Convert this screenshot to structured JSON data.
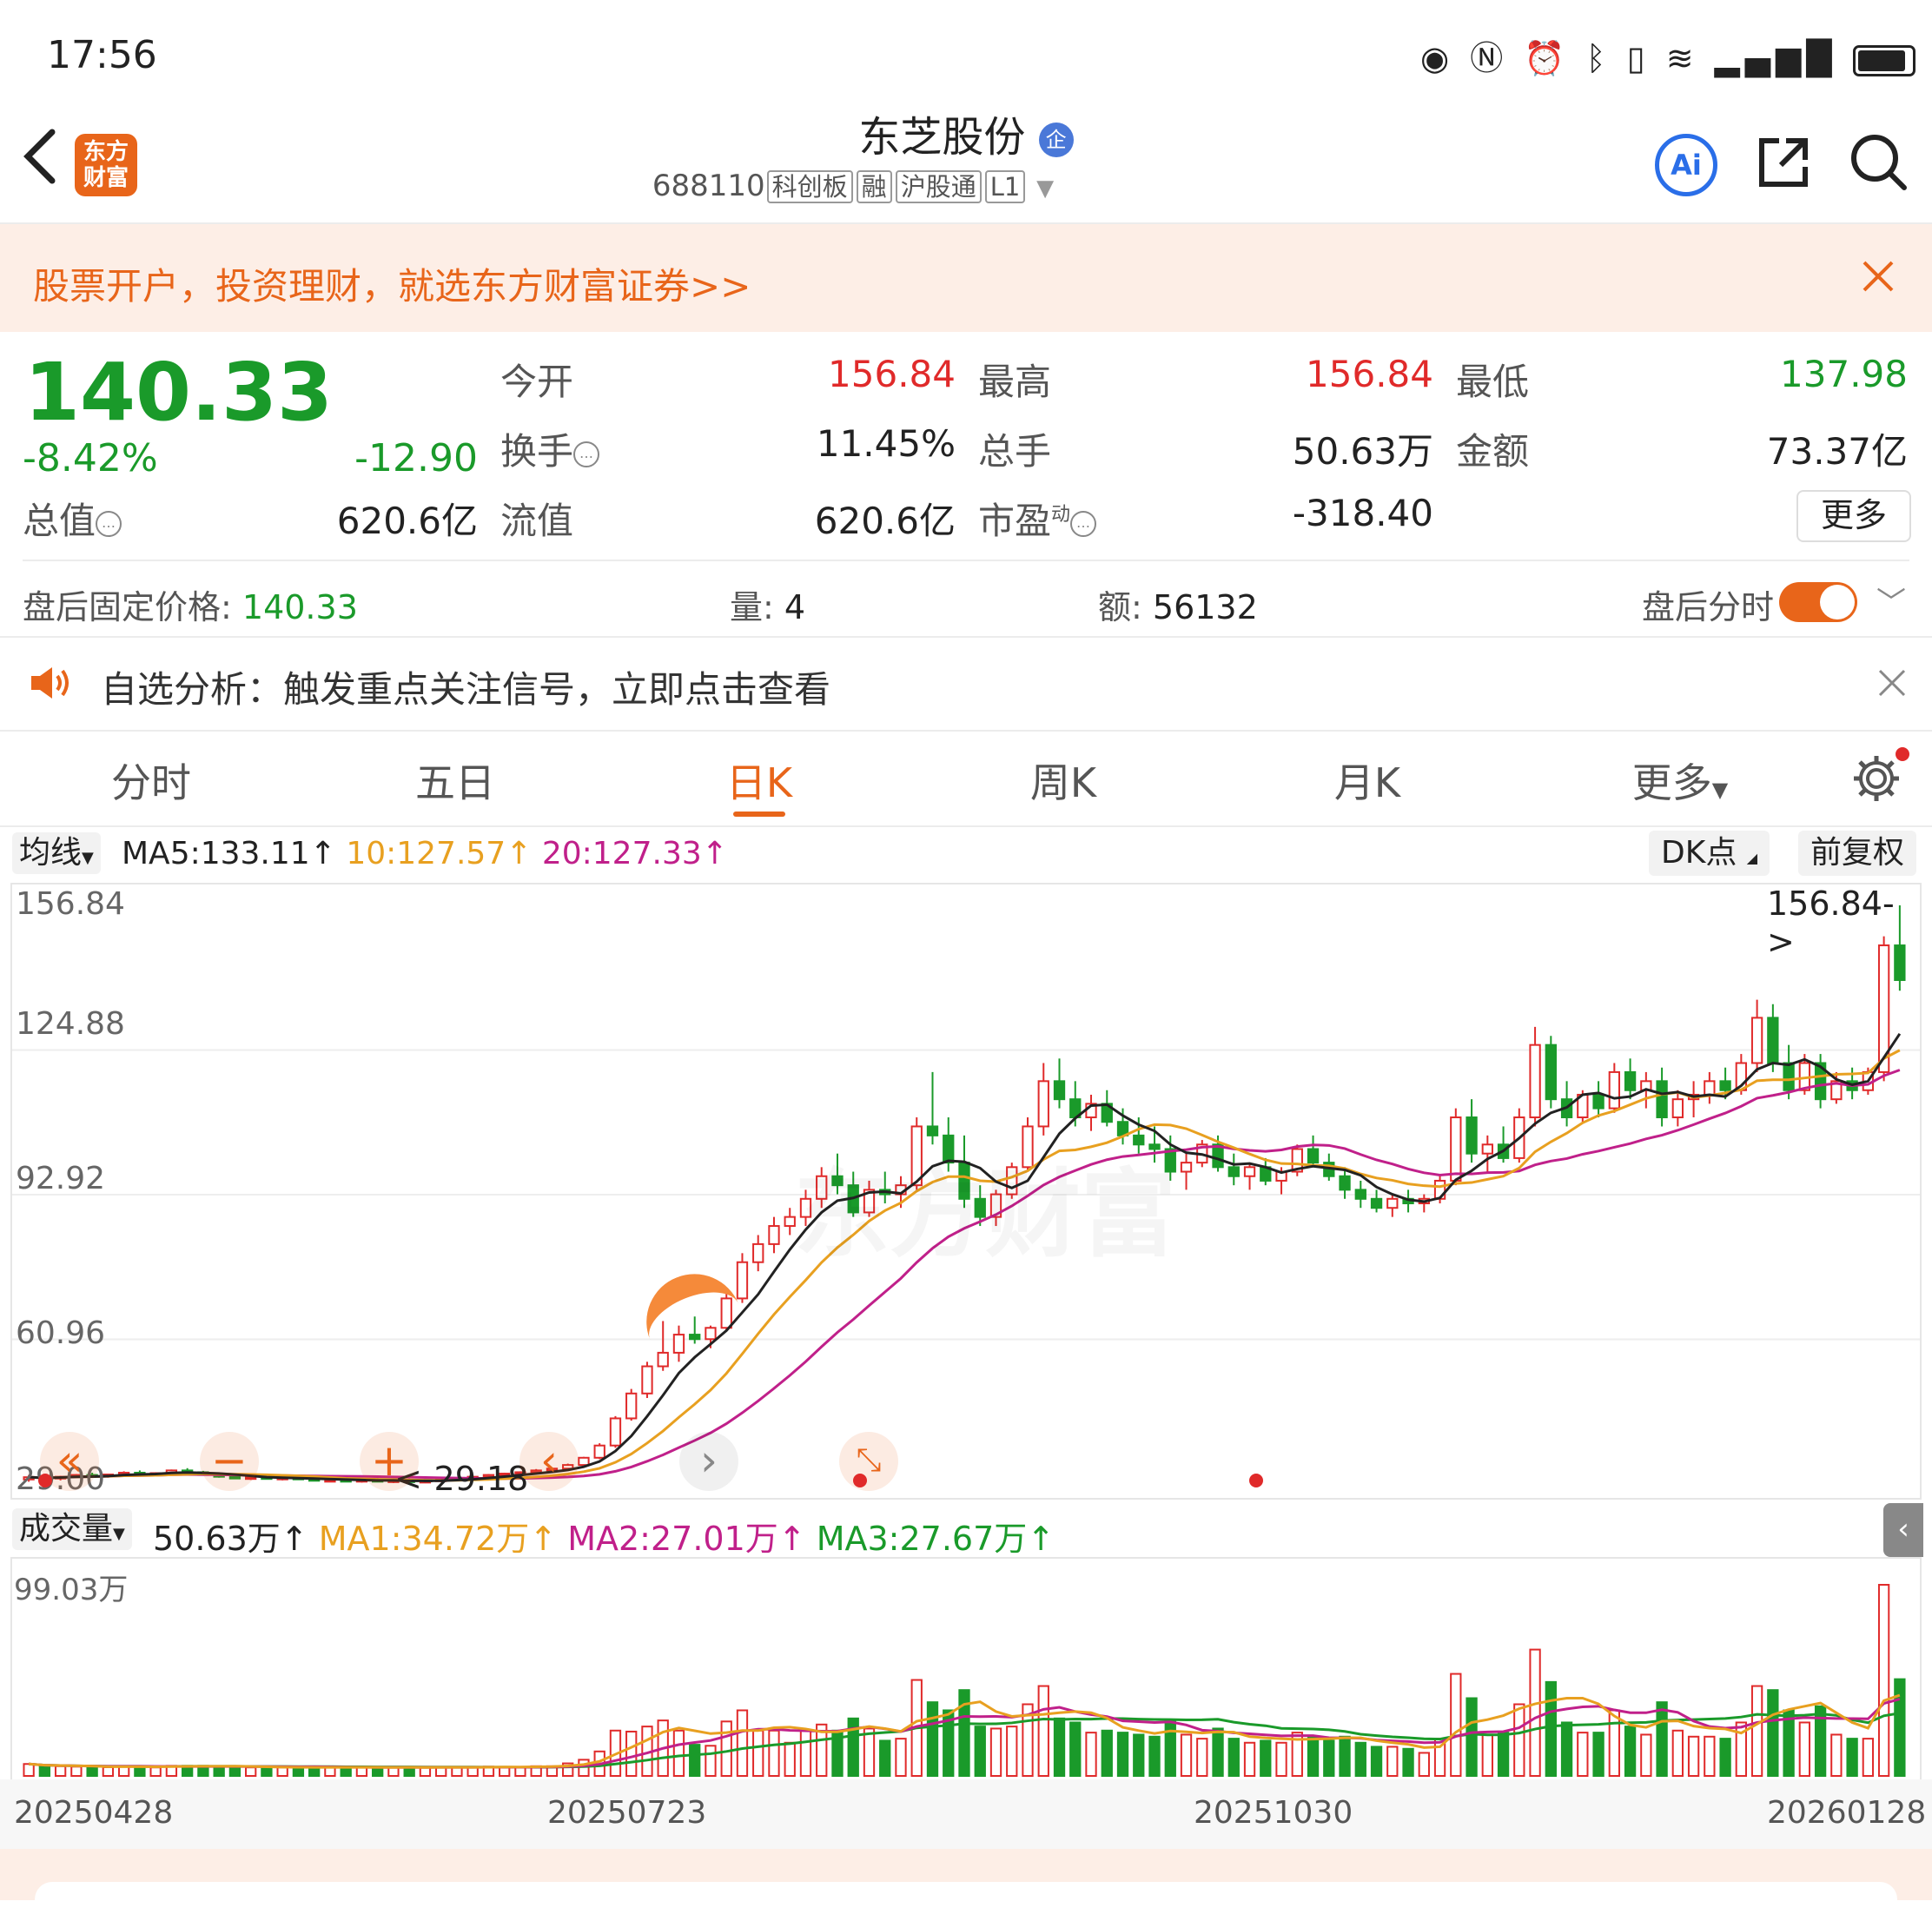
{
  "status_bar": {
    "time": "17:56"
  },
  "header": {
    "back_icon": "chevron-left-icon",
    "logo_text_top": "东方",
    "logo_text_bottom": "财富",
    "title": "东芝股份",
    "badge": "企",
    "code": "688110",
    "tags": [
      "科创板",
      "融",
      "沪股通",
      "L1"
    ],
    "actions": [
      "ai-icon",
      "share-icon",
      "search-icon"
    ],
    "ai_label": "Ai"
  },
  "banner": {
    "text": "股票开户，投资理财，就选东方财富证券>>"
  },
  "quote": {
    "price": "140.33",
    "change_pct": "-8.42%",
    "change": "-12.90",
    "labels": {
      "open": "今开",
      "high": "最高",
      "low": "最低",
      "turnover": "换手",
      "volume": "总手",
      "amount": "金额",
      "mkt_cap": "总值",
      "float_cap": "流值",
      "pe": "市盈",
      "pe_sup": "动"
    },
    "values": {
      "open": "156.84",
      "high": "156.84",
      "low": "137.98",
      "turnover": "11.45%",
      "volume": "50.63万",
      "amount": "73.37亿",
      "mkt_cap": "620.6亿",
      "float_cap": "620.6亿",
      "pe": "-318.40"
    },
    "more_button": "更多"
  },
  "after_hours": {
    "price_label": "盘后固定价格:",
    "price": "140.33",
    "vol_label": "量:",
    "vol": "4",
    "amt_label": "额:",
    "amt": "56132",
    "toggle_label": "盘后分时"
  },
  "notice": {
    "text": "自选分析：触发重点关注信号，立即点击查看"
  },
  "tabs": [
    "分时",
    "五日",
    "日K",
    "周K",
    "月K",
    "更多"
  ],
  "active_tab": "日K",
  "ma_bar": {
    "selector": "均线",
    "ma5": "MA5:133.11↑",
    "ma10": "10:127.57↑",
    "ma20": "20:127.33↑",
    "dk": "DK点",
    "fq": "前复权"
  },
  "price_axis": [
    "156.84",
    "124.88",
    "92.92",
    "60.96",
    "29.00"
  ],
  "marks": {
    "max": "156.84->",
    "min": "<-29.18"
  },
  "vol_bar": {
    "selector": "成交量",
    "vol": "50.63万↑",
    "ma1": "MA1:34.72万↑",
    "ma2": "MA2:27.01万↑",
    "ma3": "MA3:27.67万↑"
  },
  "vol_axis": {
    "top": "99.03万"
  },
  "date_axis": [
    "20250428",
    "20250723",
    "20251030",
    "20260128"
  ],
  "colors": {
    "up": "#e02a2a",
    "down": "#1a9a2a",
    "accent": "#e8651a",
    "ma5": "#222222",
    "ma10": "#e8a020",
    "ma20": "#c0208a"
  },
  "chart_data": {
    "type": "candlestick",
    "ylim": [
      29.0,
      156.84
    ],
    "candles": [
      [
        30,
        31,
        29.5,
        30.5
      ],
      [
        30.5,
        31,
        30,
        30.2
      ],
      [
        30.2,
        30.8,
        29.8,
        30.6
      ],
      [
        30.6,
        31.2,
        30.3,
        31
      ],
      [
        31,
        31.5,
        30.6,
        30.8
      ],
      [
        30.8,
        31.2,
        30.4,
        31.1
      ],
      [
        31.1,
        31.8,
        30.8,
        31.5
      ],
      [
        31.5,
        32,
        31,
        31.2
      ],
      [
        31.2,
        31.6,
        30.8,
        31.4
      ],
      [
        31.4,
        32.2,
        31.2,
        32
      ],
      [
        32,
        32.5,
        31.4,
        31.6
      ],
      [
        31.6,
        31.9,
        30.9,
        31
      ],
      [
        31,
        31.3,
        30.4,
        30.6
      ],
      [
        30.6,
        31,
        30.1,
        30.3
      ],
      [
        30.3,
        30.7,
        29.9,
        30.5
      ],
      [
        30.5,
        30.9,
        30.1,
        30.2
      ],
      [
        30.2,
        30.6,
        29.8,
        30.4
      ],
      [
        30.4,
        30.8,
        30,
        30.1
      ],
      [
        30.1,
        30.4,
        29.6,
        29.8
      ],
      [
        29.8,
        30.2,
        29.4,
        29.9
      ],
      [
        29.9,
        30.3,
        29.5,
        29.7
      ],
      [
        29.7,
        30.1,
        29.3,
        29.9
      ],
      [
        29.9,
        30.3,
        29.5,
        29.6
      ],
      [
        29.6,
        30,
        29.2,
        29.8
      ],
      [
        29.8,
        30.2,
        29.4,
        29.5
      ],
      [
        29.5,
        29.9,
        29.18,
        29.7
      ],
      [
        29.7,
        30.2,
        29.4,
        30
      ],
      [
        30,
        30.5,
        29.7,
        30.3
      ],
      [
        30.3,
        30.8,
        30,
        30.6
      ],
      [
        30.6,
        31.2,
        30.3,
        31
      ],
      [
        31,
        31.5,
        30.6,
        31.3
      ],
      [
        31.3,
        31.8,
        31,
        31.6
      ],
      [
        31.6,
        32.3,
        31.3,
        32
      ],
      [
        32,
        32.6,
        31.6,
        32.4
      ],
      [
        32.4,
        33.5,
        32,
        33.2
      ],
      [
        33.2,
        35,
        33,
        34.8
      ],
      [
        34.8,
        38,
        34.5,
        37.5
      ],
      [
        37.5,
        44,
        37,
        43.5
      ],
      [
        43.5,
        50,
        43,
        49
      ],
      [
        49,
        56,
        48,
        55
      ],
      [
        55,
        65,
        54,
        58
      ],
      [
        58,
        64,
        56,
        62
      ],
      [
        62,
        66,
        60,
        61
      ],
      [
        61,
        64,
        59,
        63.5
      ],
      [
        63.5,
        72,
        63,
        70
      ],
      [
        70,
        80,
        69,
        78
      ],
      [
        78,
        84,
        76,
        82
      ],
      [
        82,
        88,
        80,
        86
      ],
      [
        86,
        90,
        84,
        88
      ],
      [
        88,
        94,
        86,
        92
      ],
      [
        92,
        99,
        90,
        97
      ],
      [
        97,
        102,
        93,
        95
      ],
      [
        95,
        98,
        88,
        89
      ],
      [
        89,
        96,
        88,
        94
      ],
      [
        94,
        98,
        91,
        93
      ],
      [
        93,
        97,
        90,
        95
      ],
      [
        95,
        110,
        94,
        108
      ],
      [
        108,
        120,
        104,
        106
      ],
      [
        106,
        110,
        98,
        100
      ],
      [
        100,
        106,
        90,
        92
      ],
      [
        92,
        95,
        86,
        88
      ],
      [
        88,
        94,
        86,
        93
      ],
      [
        93,
        100,
        92,
        99
      ],
      [
        99,
        110,
        98,
        108
      ],
      [
        108,
        122,
        106,
        118
      ],
      [
        118,
        123,
        112,
        114
      ],
      [
        114,
        118,
        108,
        110
      ],
      [
        110,
        115,
        107,
        113
      ],
      [
        113,
        116,
        108,
        109
      ],
      [
        109,
        112,
        104,
        106
      ],
      [
        106,
        110,
        102,
        104
      ],
      [
        104,
        108,
        100,
        103
      ],
      [
        103,
        106,
        96,
        98
      ],
      [
        98,
        102,
        94,
        100
      ],
      [
        100,
        105,
        99,
        104
      ],
      [
        104,
        106,
        98,
        99
      ],
      [
        99,
        102,
        95,
        97
      ],
      [
        97,
        100,
        94,
        99
      ],
      [
        99,
        101,
        95,
        96
      ],
      [
        96,
        99,
        93,
        98
      ],
      [
        98,
        104,
        97,
        103
      ],
      [
        103,
        106,
        99,
        100
      ],
      [
        100,
        102,
        96,
        97
      ],
      [
        97,
        99,
        92,
        94
      ],
      [
        94,
        96,
        90,
        92
      ],
      [
        92,
        94,
        89,
        90
      ],
      [
        90,
        93,
        88,
        92
      ],
      [
        92,
        94,
        89,
        91
      ],
      [
        91,
        93,
        89,
        92
      ],
      [
        92,
        97,
        91,
        96
      ],
      [
        96,
        112,
        95,
        110
      ],
      [
        110,
        114,
        100,
        102
      ],
      [
        102,
        106,
        98,
        104
      ],
      [
        104,
        108,
        100,
        101
      ],
      [
        101,
        112,
        100,
        110
      ],
      [
        110,
        130,
        108,
        126
      ],
      [
        126,
        128,
        112,
        114
      ],
      [
        114,
        118,
        108,
        110
      ],
      [
        110,
        116,
        109,
        115
      ],
      [
        115,
        118,
        110,
        112
      ],
      [
        112,
        122,
        111,
        120
      ],
      [
        120,
        123,
        114,
        116
      ],
      [
        116,
        120,
        112,
        118
      ],
      [
        118,
        121,
        108,
        110
      ],
      [
        110,
        116,
        108,
        114
      ],
      [
        114,
        118,
        110,
        115
      ],
      [
        115,
        120,
        113,
        118
      ],
      [
        118,
        121,
        114,
        116
      ],
      [
        116,
        124,
        115,
        122
      ],
      [
        122,
        136,
        120,
        132
      ],
      [
        132,
        135,
        120,
        122
      ],
      [
        122,
        126,
        114,
        116
      ],
      [
        116,
        124,
        115,
        122
      ],
      [
        122,
        124,
        112,
        114
      ],
      [
        114,
        120,
        113,
        118
      ],
      [
        118,
        121,
        114,
        116
      ],
      [
        116,
        121,
        115,
        120
      ],
      [
        120,
        150,
        118,
        148
      ],
      [
        148,
        156.84,
        137.98,
        140.33
      ]
    ]
  }
}
